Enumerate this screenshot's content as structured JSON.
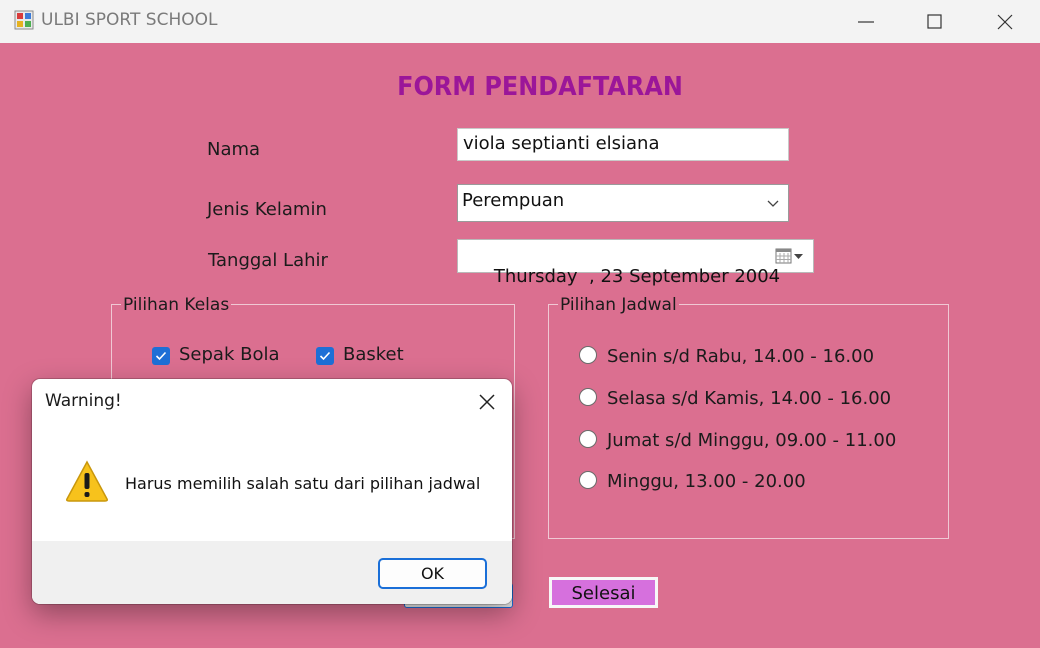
{
  "window": {
    "title": "ULBI SPORT SCHOOL"
  },
  "form": {
    "title": "FORM PENDAFTARAN",
    "nama_label": "Nama",
    "nama_value": "viola septianti elsiana",
    "jenis_kelamin_label": "Jenis Kelamin",
    "jenis_kelamin_value": "Perempuan",
    "tanggal_lahir_label": "Tanggal Lahir",
    "tanggal_lahir_value": "Thursday  , 23 September 2004"
  },
  "kelas": {
    "legend": "Pilihan Kelas",
    "options": [
      {
        "label": "Sepak Bola",
        "checked": true
      },
      {
        "label": "Basket",
        "checked": true
      }
    ]
  },
  "jadwal": {
    "legend": "Pilihan Jadwal",
    "options": [
      {
        "label": "Senin s/d Rabu, 14.00 - 16.00",
        "selected": false
      },
      {
        "label": "Selasa s/d Kamis, 14.00 - 16.00",
        "selected": false
      },
      {
        "label": "Jumat s/d Minggu, 09.00 - 11.00",
        "selected": false
      },
      {
        "label": "Minggu, 13.00 - 20.00",
        "selected": false
      }
    ]
  },
  "buttons": {
    "selesai": "Selesai"
  },
  "dialog": {
    "title": "Warning!",
    "message": "Harus memilih salah satu dari pilihan jadwal",
    "ok": "OK",
    "icon": "warning-icon"
  },
  "colors": {
    "form_background": "#db6f90",
    "title_color": "#9b1699",
    "checkbox_accent": "#1e6fd6",
    "selesai_button": "#d670dd",
    "dialog_button_border": "#1a6fd8"
  }
}
